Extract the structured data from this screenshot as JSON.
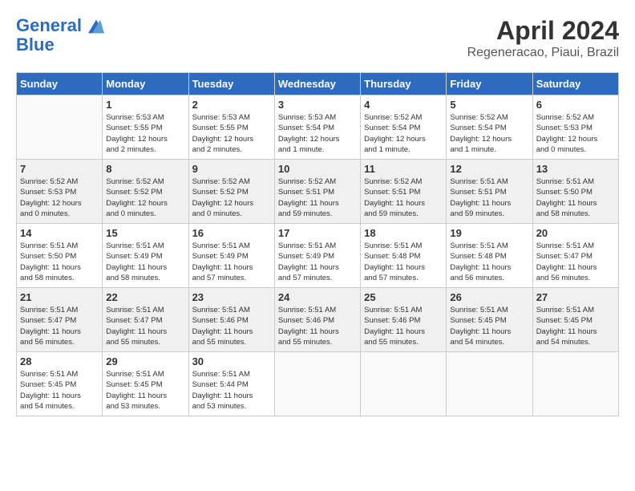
{
  "header": {
    "logo_line1": "General",
    "logo_line2": "Blue",
    "month": "April 2024",
    "location": "Regeneracao, Piaui, Brazil"
  },
  "weekdays": [
    "Sunday",
    "Monday",
    "Tuesday",
    "Wednesday",
    "Thursday",
    "Friday",
    "Saturday"
  ],
  "weeks": [
    [
      {
        "day": "",
        "info": ""
      },
      {
        "day": "1",
        "info": "Sunrise: 5:53 AM\nSunset: 5:55 PM\nDaylight: 12 hours\nand 2 minutes."
      },
      {
        "day": "2",
        "info": "Sunrise: 5:53 AM\nSunset: 5:55 PM\nDaylight: 12 hours\nand 2 minutes."
      },
      {
        "day": "3",
        "info": "Sunrise: 5:53 AM\nSunset: 5:54 PM\nDaylight: 12 hours\nand 1 minute."
      },
      {
        "day": "4",
        "info": "Sunrise: 5:52 AM\nSunset: 5:54 PM\nDaylight: 12 hours\nand 1 minute."
      },
      {
        "day": "5",
        "info": "Sunrise: 5:52 AM\nSunset: 5:54 PM\nDaylight: 12 hours\nand 1 minute."
      },
      {
        "day": "6",
        "info": "Sunrise: 5:52 AM\nSunset: 5:53 PM\nDaylight: 12 hours\nand 0 minutes."
      }
    ],
    [
      {
        "day": "7",
        "info": "Sunrise: 5:52 AM\nSunset: 5:53 PM\nDaylight: 12 hours\nand 0 minutes."
      },
      {
        "day": "8",
        "info": "Sunrise: 5:52 AM\nSunset: 5:52 PM\nDaylight: 12 hours\nand 0 minutes."
      },
      {
        "day": "9",
        "info": "Sunrise: 5:52 AM\nSunset: 5:52 PM\nDaylight: 12 hours\nand 0 minutes."
      },
      {
        "day": "10",
        "info": "Sunrise: 5:52 AM\nSunset: 5:51 PM\nDaylight: 11 hours\nand 59 minutes."
      },
      {
        "day": "11",
        "info": "Sunrise: 5:52 AM\nSunset: 5:51 PM\nDaylight: 11 hours\nand 59 minutes."
      },
      {
        "day": "12",
        "info": "Sunrise: 5:51 AM\nSunset: 5:51 PM\nDaylight: 11 hours\nand 59 minutes."
      },
      {
        "day": "13",
        "info": "Sunrise: 5:51 AM\nSunset: 5:50 PM\nDaylight: 11 hours\nand 58 minutes."
      }
    ],
    [
      {
        "day": "14",
        "info": "Sunrise: 5:51 AM\nSunset: 5:50 PM\nDaylight: 11 hours\nand 58 minutes."
      },
      {
        "day": "15",
        "info": "Sunrise: 5:51 AM\nSunset: 5:49 PM\nDaylight: 11 hours\nand 58 minutes."
      },
      {
        "day": "16",
        "info": "Sunrise: 5:51 AM\nSunset: 5:49 PM\nDaylight: 11 hours\nand 57 minutes."
      },
      {
        "day": "17",
        "info": "Sunrise: 5:51 AM\nSunset: 5:49 PM\nDaylight: 11 hours\nand 57 minutes."
      },
      {
        "day": "18",
        "info": "Sunrise: 5:51 AM\nSunset: 5:48 PM\nDaylight: 11 hours\nand 57 minutes."
      },
      {
        "day": "19",
        "info": "Sunrise: 5:51 AM\nSunset: 5:48 PM\nDaylight: 11 hours\nand 56 minutes."
      },
      {
        "day": "20",
        "info": "Sunrise: 5:51 AM\nSunset: 5:47 PM\nDaylight: 11 hours\nand 56 minutes."
      }
    ],
    [
      {
        "day": "21",
        "info": "Sunrise: 5:51 AM\nSunset: 5:47 PM\nDaylight: 11 hours\nand 56 minutes."
      },
      {
        "day": "22",
        "info": "Sunrise: 5:51 AM\nSunset: 5:47 PM\nDaylight: 11 hours\nand 55 minutes."
      },
      {
        "day": "23",
        "info": "Sunrise: 5:51 AM\nSunset: 5:46 PM\nDaylight: 11 hours\nand 55 minutes."
      },
      {
        "day": "24",
        "info": "Sunrise: 5:51 AM\nSunset: 5:46 PM\nDaylight: 11 hours\nand 55 minutes."
      },
      {
        "day": "25",
        "info": "Sunrise: 5:51 AM\nSunset: 5:46 PM\nDaylight: 11 hours\nand 55 minutes."
      },
      {
        "day": "26",
        "info": "Sunrise: 5:51 AM\nSunset: 5:45 PM\nDaylight: 11 hours\nand 54 minutes."
      },
      {
        "day": "27",
        "info": "Sunrise: 5:51 AM\nSunset: 5:45 PM\nDaylight: 11 hours\nand 54 minutes."
      }
    ],
    [
      {
        "day": "28",
        "info": "Sunrise: 5:51 AM\nSunset: 5:45 PM\nDaylight: 11 hours\nand 54 minutes."
      },
      {
        "day": "29",
        "info": "Sunrise: 5:51 AM\nSunset: 5:45 PM\nDaylight: 11 hours\nand 53 minutes."
      },
      {
        "day": "30",
        "info": "Sunrise: 5:51 AM\nSunset: 5:44 PM\nDaylight: 11 hours\nand 53 minutes."
      },
      {
        "day": "",
        "info": ""
      },
      {
        "day": "",
        "info": ""
      },
      {
        "day": "",
        "info": ""
      },
      {
        "day": "",
        "info": ""
      }
    ]
  ]
}
